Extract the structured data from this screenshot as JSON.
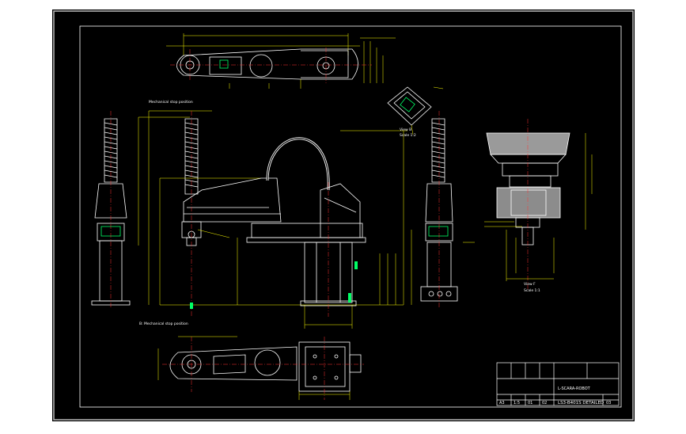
{
  "drawing": {
    "colors": {
      "page": "#ffffff",
      "sheet": "#000000",
      "outline": "#ffffff",
      "dimension": "#ffff00",
      "centerline": "#ff3030",
      "highlight": "#00ff66",
      "section_fill": "#8c8c8c",
      "part_fill": "#9a9a9a"
    },
    "views": {
      "top": "top-view",
      "front": "front-view",
      "side_left": "side-view-left",
      "side_right": "side-view-right",
      "bottom": "bottom-view",
      "iso": "iso-view",
      "detail": "detail-view"
    },
    "annotations": {
      "front_note": "Mechanical stop position",
      "bottom_note": "B: Mechanical stop position",
      "detail_view": "View F",
      "detail_scale": "Scale 1:1",
      "iso_view": "View B",
      "iso_scale": "Scale 1:2"
    },
    "title_block": {
      "title": "L-SCARA-ROBOT",
      "drawing_no": "LS3-B401S DETAILED",
      "sheet": "03",
      "cells": [
        "A3",
        "1:5",
        "01",
        "02"
      ]
    }
  }
}
